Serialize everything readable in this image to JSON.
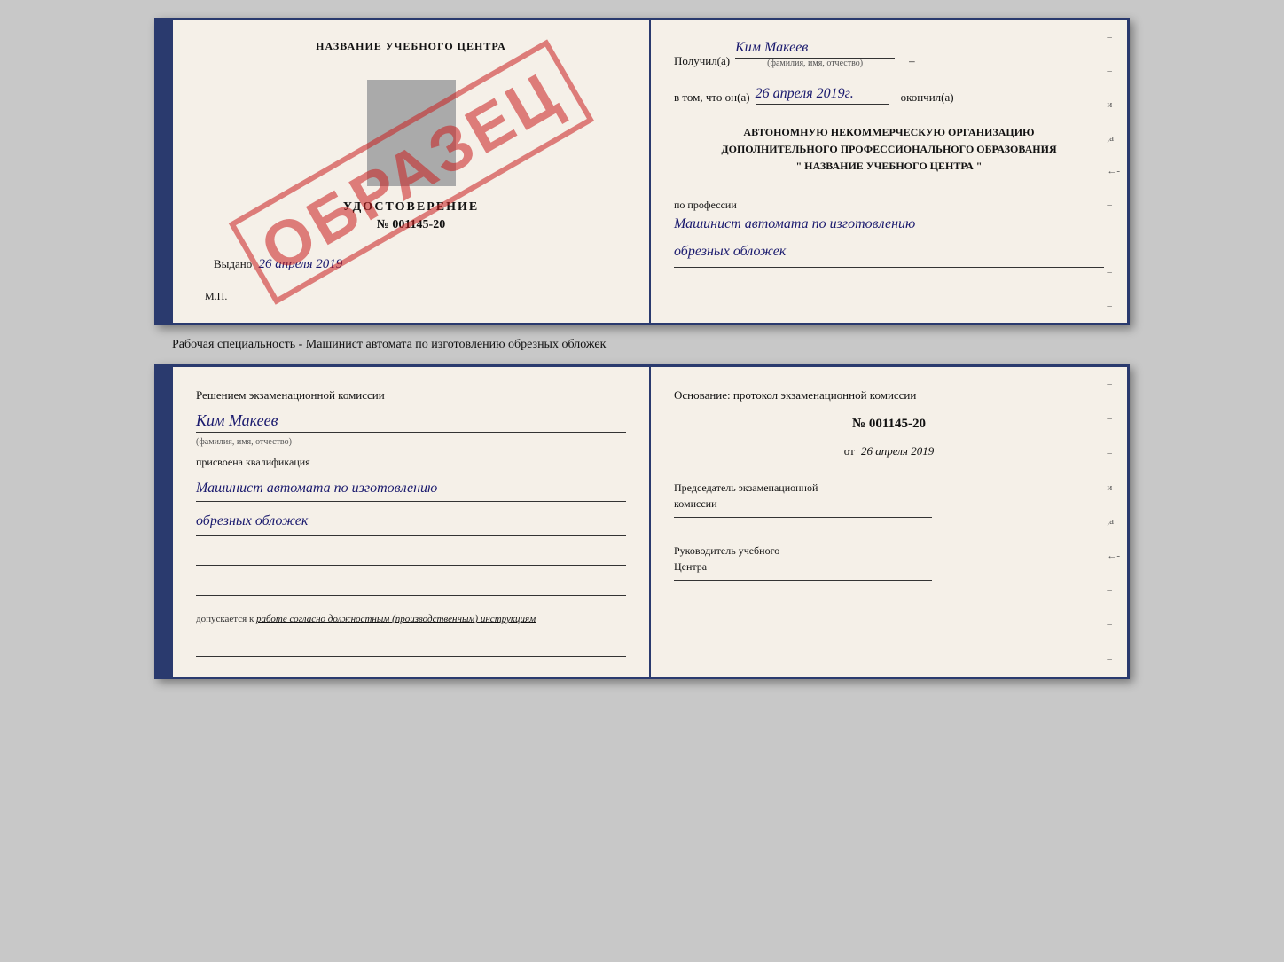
{
  "topDoc": {
    "left": {
      "title": "НАЗВАНИЕ УЧЕБНОГО ЦЕНТРА",
      "certLabel": "УДОСТОВЕРЕНИЕ",
      "certNumber": "№ 001145-20",
      "issuedPrefix": "Выдано",
      "issuedDate": "26 апреля 2019",
      "mpLabel": "М.П.",
      "watermark": "ОБРАЗЕЦ"
    },
    "right": {
      "receivedPrefix": "Получил(а)",
      "receivedName": "Ким Макеев",
      "receivedSubLabel": "(фамилия, имя, отчество)",
      "inThatPrefix": "в том, что он(а)",
      "inThatDate": "26 апреля 2019г.",
      "completedLabel": "окончил(а)",
      "orgLine1": "АВТОНОМНУЮ НЕКОММЕРЧЕСКУЮ ОРГАНИЗАЦИЮ",
      "orgLine2": "ДОПОЛНИТЕЛЬНОГО ПРОФЕССИОНАЛЬНОГО ОБРАЗОВАНИЯ",
      "orgLine3": "\"  НАЗВАНИЕ УЧЕБНОГО ЦЕНТРА  \"",
      "professionLabel": "по профессии",
      "profLine1": "Машинист автомата по изготовлению",
      "profLine2": "обрезных обложек"
    }
  },
  "caption": "Рабочая специальность - Машинист автомата по изготовлению обрезных обложек",
  "bottomDoc": {
    "left": {
      "heading": "Решением экзаменационной комиссии",
      "name": "Ким Макеев",
      "nameSubLabel": "(фамилия, имя, отчество)",
      "assignedLabel": "присвоена квалификация",
      "profLine1": "Машинист автомата по изготовлению",
      "profLine2": "обрезных обложек",
      "допускPrefix": "допускается к",
      "допускValue": "работе согласно должностным (производственным) инструкциям"
    },
    "right": {
      "heading": "Основание: протокол экзаменационной комиссии",
      "number": "№ 001145-20",
      "datePrefix": "от",
      "date": "26 апреля 2019",
      "chairLabel1": "Председатель экзаменационной",
      "chairLabel2": "комиссии",
      "headLabel1": "Руководитель учебного",
      "headLabel2": "Центра"
    }
  }
}
